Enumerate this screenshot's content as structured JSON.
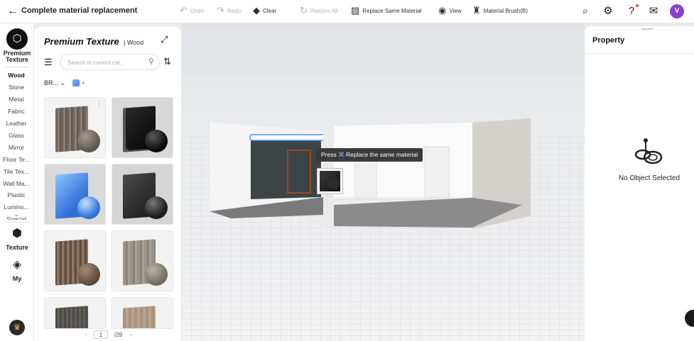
{
  "header": {
    "title": "Complete material replacement",
    "tools": [
      {
        "id": "undo",
        "label": "Undo",
        "icon": "undo-icon",
        "enabled": false
      },
      {
        "id": "redo",
        "label": "Redo",
        "icon": "redo-icon",
        "enabled": false
      },
      {
        "id": "clear",
        "label": "Clear",
        "icon": "eraser-icon",
        "enabled": true
      },
      {
        "id": "restore",
        "label": "Restore All",
        "icon": "restore-icon",
        "enabled": false
      },
      {
        "id": "replace-same",
        "label": "Replace Same Material",
        "icon": "replace-icon",
        "enabled": true
      },
      {
        "id": "view",
        "label": "View",
        "icon": "eye-icon",
        "enabled": true
      },
      {
        "id": "brush",
        "label": "Material Brush(B)",
        "icon": "brush-icon",
        "enabled": true
      }
    ],
    "user_initial": "V"
  },
  "rail": {
    "title_line1": "Premium",
    "title_line2": "Texture",
    "categories": [
      "Wood",
      "Stone",
      "Metal",
      "Fabric",
      "Leather",
      "Glass",
      "Mirror",
      "Floor Te...",
      "Tile Tex...",
      "Wall Ma...",
      "Plastic",
      "Lumino...",
      "Special"
    ],
    "active_category": "Wood",
    "texture_label": "Texture",
    "my_label": "My"
  },
  "panel": {
    "title": "Premium Texture",
    "subtitle": "| Wood",
    "search_placeholder": "Search in current cat...",
    "brand_filter": "BR...",
    "page": "1",
    "total_pages": "/29",
    "thumbnails": [
      {
        "name": "weathered-grey-wood"
      },
      {
        "name": "black-glossy"
      },
      {
        "name": "blue-glossy"
      },
      {
        "name": "dark-grey-glossy"
      },
      {
        "name": "striped-brown-wood"
      },
      {
        "name": "light-grey-wood"
      },
      {
        "name": "dark-wood-planks"
      },
      {
        "name": "light-tan-wood"
      }
    ]
  },
  "viewport": {
    "tooltip_prefix": "Press",
    "tooltip_key": "⌘",
    "tooltip_text": "Replace the same material"
  },
  "property": {
    "title": "Property",
    "empty_text": "No Object Selected"
  }
}
